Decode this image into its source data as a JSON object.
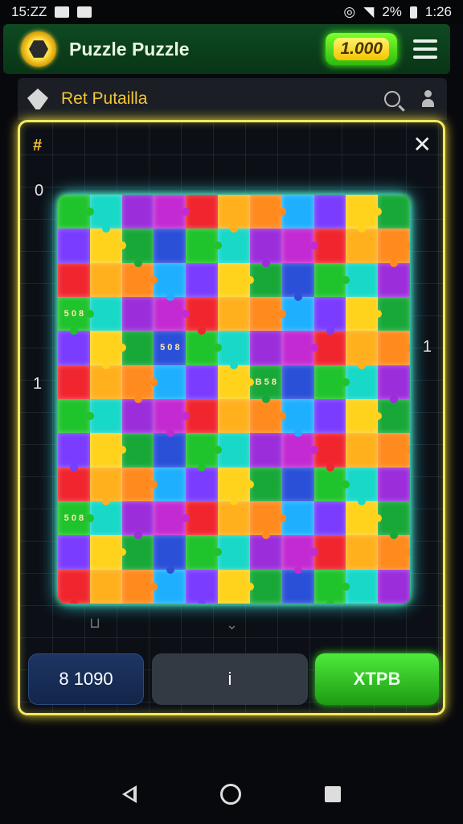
{
  "status_bar": {
    "time_left": "15:ZZ",
    "battery": "2%",
    "time_right": "1:26"
  },
  "header": {
    "title": "Puzzle Puzzle",
    "coins": "1.000"
  },
  "subheader": {
    "title": "Ret Putailla"
  },
  "board": {
    "left_labels": [
      "0",
      "1"
    ],
    "right_label": "1",
    "piece_texts": [
      "5 0 8",
      "5 0 8",
      "5 0 8",
      "B 5 8"
    ],
    "colors": [
      "#1fc32c",
      "#1eb0ff",
      "#9b2ddb",
      "#ffd21c",
      "#f0252e",
      "#2a50d8",
      "#ff8a1e",
      "#18d8c8",
      "#7a3cff",
      "#c42ad2",
      "#18a838",
      "#ffb01c"
    ]
  },
  "buttons": {
    "score": "8 1090",
    "middle": "i",
    "go": "ΧΤΡΒ"
  },
  "colors": {
    "accent": "#f6e85a",
    "primary_green": "#0e4a22",
    "board_glow": "#3ff2ff"
  }
}
